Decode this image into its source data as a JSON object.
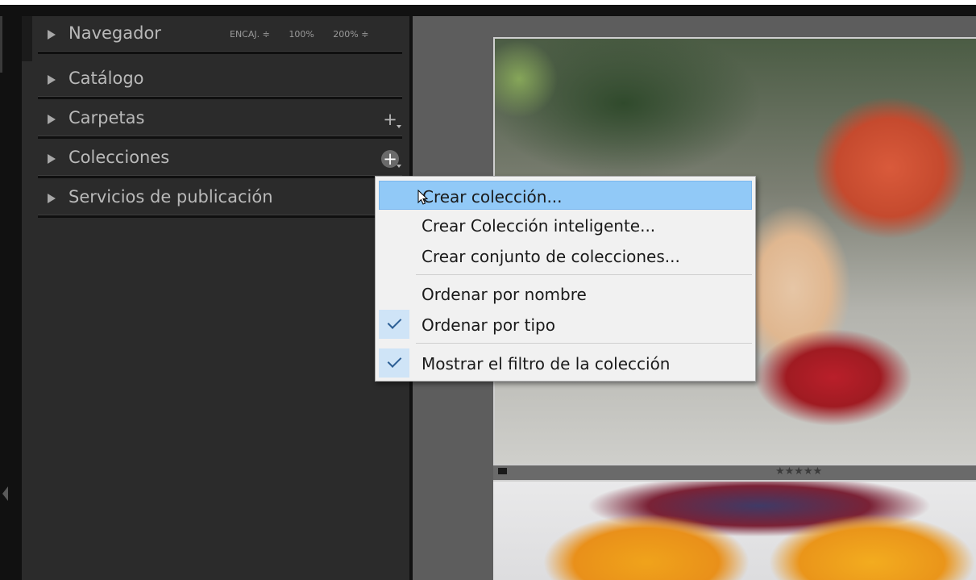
{
  "panel": {
    "navegador": {
      "title": "Navegador",
      "opt_fit": "ENCAJ. ≑",
      "opt_100": "100%",
      "opt_200": "200% ≑"
    },
    "catalogo": {
      "title": "Catálogo"
    },
    "carpetas": {
      "title": "Carpetas",
      "add": "+"
    },
    "colecciones": {
      "title": "Colecciones",
      "add": "+"
    },
    "servicios": {
      "title": "Servicios de publicación"
    }
  },
  "filmstrip": {
    "stars": "★★★★★"
  },
  "menu": {
    "items": [
      {
        "label": "Crear colección...",
        "highlighted": true
      },
      {
        "label": "Crear Colección inteligente..."
      },
      {
        "label": "Crear conjunto de colecciones..."
      },
      {
        "label": "Ordenar por nombre"
      },
      {
        "label": "Ordenar por tipo",
        "checked": true
      },
      {
        "label": "Mostrar el filtro de la colección",
        "checked": true
      }
    ]
  },
  "colors": {
    "panel_bg": "#2b2b2b",
    "menu_bg": "#f1f1f1",
    "menu_highlight": "#91c9f7",
    "check_color": "#2d5f95"
  }
}
